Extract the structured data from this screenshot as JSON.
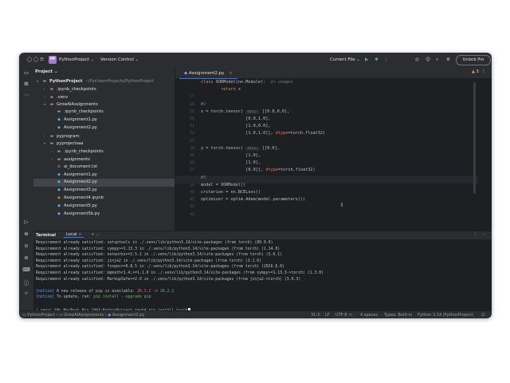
{
  "titlebar": {
    "project_badge": "PP",
    "project_name": "PythonProject",
    "vcs": "Version Control",
    "run_config": "Current File",
    "unlock_label": "Unlock Pro"
  },
  "project_panel": {
    "title": "Project",
    "tree": [
      {
        "indent": 0,
        "arrow": "▾",
        "icon": "folder",
        "label": "PythonProject",
        "path": "~/PycharmProjects/PythonProject",
        "bold": true
      },
      {
        "indent": 1,
        "arrow": "›",
        "icon": "folder",
        "label": ".ipynb_checkpoints"
      },
      {
        "indent": 1,
        "arrow": "›",
        "icon": "folder-orange",
        "label": ".venv"
      },
      {
        "indent": 1,
        "arrow": "▾",
        "icon": "folder",
        "label": "GrowAIAssignments"
      },
      {
        "indent": 2,
        "arrow": "",
        "icon": "folder",
        "label": ".ipynb_checkpoints"
      },
      {
        "indent": 2,
        "arrow": "",
        "icon": "py",
        "label": "Assignment1.py"
      },
      {
        "indent": 2,
        "arrow": "",
        "icon": "py",
        "label": "Assignment2.py"
      },
      {
        "indent": 1,
        "arrow": "›",
        "icon": "folder",
        "label": "pyprogram"
      },
      {
        "indent": 1,
        "arrow": "▾",
        "icon": "folder",
        "label": "pyprojectsaa"
      },
      {
        "indent": 2,
        "arrow": "›",
        "icon": "folder",
        "label": ".ipynb_checkpoints"
      },
      {
        "indent": 2,
        "arrow": "›",
        "icon": "folder",
        "label": "assignments"
      },
      {
        "indent": 2,
        "arrow": "",
        "icon": "txt",
        "label": "ai_document.txt"
      },
      {
        "indent": 2,
        "arrow": "",
        "icon": "py",
        "label": "Assignment1.py"
      },
      {
        "indent": 2,
        "arrow": "",
        "icon": "py",
        "label": "Assignment2.py",
        "selected": true
      },
      {
        "indent": 2,
        "arrow": "",
        "icon": "py",
        "label": "Assignment3.py"
      },
      {
        "indent": 2,
        "arrow": "",
        "icon": "nb",
        "label": "Assignment4.ipynb"
      },
      {
        "indent": 2,
        "arrow": "",
        "icon": "py",
        "label": "Assignment5.py"
      },
      {
        "indent": 2,
        "arrow": "",
        "icon": "py",
        "label": "Assignment5b.py"
      }
    ]
  },
  "editor": {
    "tab_label": "Assignment2.py",
    "inspection_count": "3",
    "line_numbers": [
      "",
      "",
      "27",
      "28",
      "29",
      "30",
      "31",
      "32",
      "33",
      "34",
      "35",
      "36",
      "37",
      "38",
      "39",
      "40",
      "41",
      "42",
      "43",
      "44",
      "45"
    ],
    "lines": [
      {
        "parts": [
          [
            "kw",
            "class "
          ],
          [
            "",
            "XORModel(nn.Module):  "
          ],
          [
            "cm",
            "2+ usages"
          ]
        ]
      },
      {
        "parts": [
          [
            "kw",
            "        return "
          ],
          [
            "",
            "x"
          ]
        ]
      },
      {
        "parts": []
      },
      {
        "parts": [
          [
            "cm",
            "#2"
          ]
        ]
      },
      {
        "parts": [
          [
            "",
            "x = torch.tensor( "
          ],
          [
            "hint",
            "data:"
          ],
          [
            "",
            " [[0.0,0.0],"
          ]
        ]
      },
      {
        "parts": [
          [
            "",
            "                  [0.0,1.0],"
          ]
        ]
      },
      {
        "parts": [
          [
            "",
            "                  [1.0,0.0],"
          ]
        ]
      },
      {
        "parts": [
          [
            "",
            "                  [1.0,1.0]], "
          ],
          [
            "prm",
            "dtype"
          ],
          [
            "",
            "=torch.float32)"
          ]
        ]
      },
      {
        "parts": []
      },
      {
        "parts": [
          [
            "",
            "y = torch.tensor( "
          ],
          [
            "hint",
            "data:"
          ],
          [
            "",
            " [[0.0],"
          ]
        ]
      },
      {
        "parts": [
          [
            "",
            "                  [1.0],"
          ]
        ]
      },
      {
        "parts": [
          [
            "",
            "                  [1.0],"
          ]
        ]
      },
      {
        "parts": [
          [
            "",
            "                  [0.0]], "
          ],
          [
            "prm",
            "dtype"
          ],
          [
            "",
            "=torch.float32)"
          ]
        ]
      },
      {
        "parts": [
          [
            "cm",
            "#3"
          ]
        ],
        "current": true
      },
      {
        "parts": [
          [
            "",
            "model = XORModel()"
          ]
        ]
      },
      {
        "parts": [
          [
            "",
            "criterion = nn.BCELoss()"
          ]
        ]
      },
      {
        "parts": [
          [
            "",
            "optimizer = optim.Adam(model.parameters())"
          ]
        ]
      },
      {
        "parts": []
      },
      {
        "parts": []
      }
    ]
  },
  "terminal": {
    "tab_terminal": "Terminal",
    "tab_local": "Local",
    "lines": [
      [
        [
          "",
          "Requirement already satisfied: setuptools in ./.venv/lib/python3.14/site-packages (from torch) (80.9.0)"
        ]
      ],
      [
        [
          "",
          "Requirement already satisfied: sympy>=1.13.3 in ./.venv/lib/python3.14/site-packages (from torch) (1.14.0)"
        ]
      ],
      [
        [
          "",
          "Requirement already satisfied: networkx>=2.5.1 in ./.venv/lib/python3.14/site-packages (from torch) (3.6.1)"
        ]
      ],
      [
        [
          "",
          "Requirement already satisfied: jinja2 in ./.venv/lib/python3.14/site-packages (from torch) (3.1.6)"
        ]
      ],
      [
        [
          "",
          "Requirement already satisfied: fsspec>=0.8.5 in ./.venv/lib/python3.14/site-packages (from torch) (2026.6.0)"
        ]
      ],
      [
        [
          "",
          "Requirement already satisfied: mpmath<1.4,>=1.1.0 in ./.venv/lib/python3.14/site-packages (from sympy>=1.13.3->torch) (1.3.0)"
        ]
      ],
      [
        [
          "",
          "Requirement already satisfied: MarkupSafe>=2.0 in ./.venv/lib/python3.14/site-packages (from jinja2->torch) (3.0.3)"
        ]
      ],
      [],
      [
        [
          "blue",
          "[notice]"
        ],
        [
          "",
          " A new release of pip is available: "
        ],
        [
          "prm",
          "26.1.2"
        ],
        [
          "",
          " -> "
        ],
        [
          "green",
          "26.2.1"
        ]
      ],
      [
        [
          "blue",
          "[notice]"
        ],
        [
          "",
          " To update, run: "
        ],
        [
          "green",
          "pip install --upgrade pip"
        ]
      ],
      [],
      [
        [
          "",
          "(.venv) SWs-MacBook-Pro-1993:PythonProject tech$ pip install torch"
        ]
      ]
    ]
  },
  "statusbar": {
    "crumb_project": "PythonProject",
    "crumb_folder": "GrowAIAssignments",
    "crumb_file": "Assignment2.py",
    "position": "31:3",
    "line_sep": "LF",
    "encoding": "UTF-8",
    "indent": "4 spaces",
    "types": "Types: Built-in",
    "interpreter": "Python 3.14 (PythonProject)"
  },
  "icons": {
    "folder": "folder-icon",
    "python_file": "python-file-icon",
    "notebook_file": "notebook-file-icon",
    "text_file": "text-file-icon",
    "run": "run-icon",
    "debug": "debug-icon",
    "search": "search-icon",
    "settings": "gear-icon"
  },
  "colors": {
    "accent": "#3574f0",
    "badge": "#a47cd8",
    "run_green": "#5fb865"
  }
}
